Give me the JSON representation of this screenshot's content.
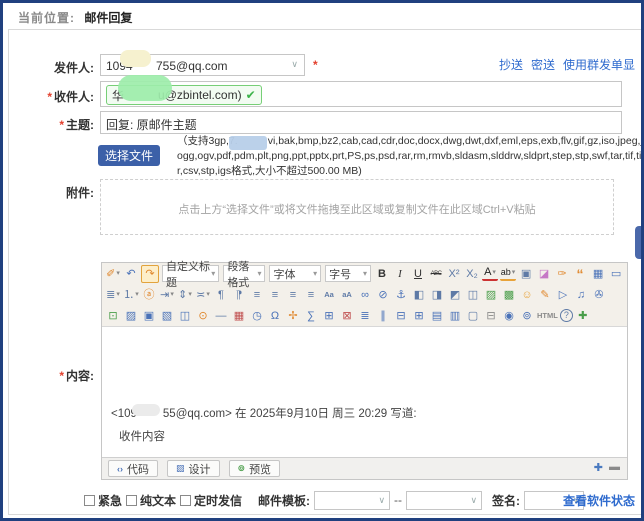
{
  "colors": {
    "frame_navy": "#20407f",
    "button_blue": "#3c60a8",
    "link_blue": "#2f6bce",
    "required_red": "#e3402e",
    "tag_green_border": "#77cf77",
    "check_green": "#3cb34a"
  },
  "breadcrumb": {
    "prefix": "当前位置:",
    "current": "邮件回复"
  },
  "form": {
    "required_mark": "*",
    "sender": {
      "label": "发件人:",
      "value_prefix": "1094",
      "value_suffix": "755@qq.com"
    },
    "header_links": [
      {
        "name": "cc-link",
        "label": "抄送"
      },
      {
        "name": "bcc-link",
        "label": "密送"
      },
      {
        "name": "group-send-link",
        "label": "使用群发单显"
      }
    ],
    "recipient": {
      "label": "收件人:",
      "tag_prefix": "华",
      "tag_suffix": "u@zbintel.com)",
      "check_icon": "✔"
    },
    "subject": {
      "label": "主题:",
      "value": "回复: 原邮件主题"
    },
    "attachment": {
      "label": "附件:",
      "choose_button": "选择文件",
      "hint_line1_pre": "（支持3gp,7.",
      "hint_line1_post": "vi,bak,bmp,bz2,cab,cad,cdr,doc,docx,dwg,dwt,dxf,eml,eps,exb,flv,gif,gz,iso,jpeg,jpg,jt",
      "hint_line2": "ogg,ogv,pdf,pdm,plt,png,ppt,pptx,prt,PS,ps,psd,rar,rm,rmvb,sldasm,slddrw,sldprt,step,stp,swf,tar,tif,tiff,txt,",
      "hint_line3": "r,csv,stp,igs格式,大小不超过500.00 MB)",
      "dropzone_text": "点击上方“选择文件”或将文件拖拽至此区域或复制文件在此区域Ctrl+V粘贴"
    },
    "content": {
      "label": "内容:"
    }
  },
  "editor": {
    "combos": [
      {
        "name": "custom-title-select",
        "label": "自定义标题"
      },
      {
        "name": "paragraph-format-select",
        "label": "段落格式"
      },
      {
        "name": "font-family-select",
        "label": "字体"
      },
      {
        "name": "font-size-select",
        "label": "字号"
      }
    ],
    "toolbar": {
      "row1_start": [
        {
          "n": "paint-format",
          "g": "✐",
          "cls": "orange drop"
        },
        {
          "n": "undo",
          "g": "↶",
          "cls": "blue"
        },
        {
          "n": "redo",
          "g": "↷",
          "cls": "orange active"
        }
      ],
      "row1_end": [
        {
          "n": "bold",
          "g": "B",
          "cls": "b"
        },
        {
          "n": "italic",
          "g": "I",
          "cls": "i"
        },
        {
          "n": "underline",
          "g": "U",
          "cls": "u"
        },
        {
          "n": "strikethrough",
          "g": "ABC",
          "cls": "st"
        },
        {
          "n": "superscript",
          "g": "X²"
        },
        {
          "n": "subscript",
          "g": "X₂"
        },
        {
          "n": "font-color",
          "g": "A",
          "cls": "fc drop"
        },
        {
          "n": "highlight-color",
          "g": "ab",
          "cls": "hc drop"
        },
        {
          "n": "bordered-text",
          "g": "▣"
        },
        {
          "n": "eraser",
          "g": "◪",
          "cls": "pink"
        },
        {
          "n": "format-painter",
          "g": "✑",
          "cls": "orange"
        },
        {
          "n": "blockquote",
          "g": "“",
          "cls": "bq"
        },
        {
          "n": "insert-calendar",
          "g": "▦",
          "cls": "blue"
        },
        {
          "n": "insert-screen",
          "g": "▭",
          "cls": "blue"
        }
      ],
      "row2": [
        {
          "n": "bullet-list",
          "g": "≣",
          "cls": "drop"
        },
        {
          "n": "ordered-list",
          "g": "⒈",
          "cls": "drop"
        },
        {
          "n": "auto-typeset",
          "g": "ⓐ",
          "cls": "orange"
        },
        {
          "n": "indent",
          "g": "⇥",
          "cls": "drop"
        },
        {
          "n": "line-height",
          "g": "⇕",
          "cls": "drop"
        },
        {
          "n": "paragraph-spacing",
          "g": "≍",
          "cls": "drop"
        },
        {
          "n": "ltr-paragraph",
          "g": "¶"
        },
        {
          "n": "rtl-paragraph",
          "g": "¶",
          "cls": "flip"
        },
        {
          "n": "align-left",
          "g": "≡"
        },
        {
          "n": "align-center",
          "g": "≡"
        },
        {
          "n": "align-right",
          "g": "≡"
        },
        {
          "n": "align-justify",
          "g": "≡"
        },
        {
          "n": "uppercase",
          "g": "Aa",
          "cls": "txt2"
        },
        {
          "n": "lowercase",
          "g": "aA",
          "cls": "txt2"
        },
        {
          "n": "insert-link",
          "g": "∞",
          "cls": "blue"
        },
        {
          "n": "unlink",
          "g": "⊘",
          "cls": "blue"
        },
        {
          "n": "anchor",
          "g": "⚓",
          "cls": "blue"
        },
        {
          "n": "image-float-left",
          "g": "◧"
        },
        {
          "n": "image-inline",
          "g": "◨"
        },
        {
          "n": "image-float-right",
          "g": "◩"
        },
        {
          "n": "image-center",
          "g": "◫"
        },
        {
          "n": "insert-image",
          "g": "▨",
          "cls": "green"
        },
        {
          "n": "photo-manager",
          "g": "▩",
          "cls": "green"
        },
        {
          "n": "emoticon",
          "g": "☺",
          "cls": "smile"
        },
        {
          "n": "scrawl",
          "g": "✎",
          "cls": "orange"
        },
        {
          "n": "insert-video",
          "g": "▷",
          "cls": "blue"
        },
        {
          "n": "insert-music",
          "g": "♫",
          "cls": "blue"
        },
        {
          "n": "attach-file",
          "g": "✇",
          "cls": "blue"
        }
      ],
      "row3": [
        {
          "n": "insert-map",
          "g": "⊡",
          "cls": "green"
        },
        {
          "n": "image-library",
          "g": "▨",
          "cls": "blue"
        },
        {
          "n": "insert-iframe",
          "g": "▣",
          "cls": "blue"
        },
        {
          "n": "page-break",
          "g": "▧",
          "cls": "blue"
        },
        {
          "n": "insert-columns",
          "g": "◫",
          "cls": "blue"
        },
        {
          "n": "snapshot",
          "g": "⊙",
          "cls": "orange"
        },
        {
          "n": "horizontal-rule",
          "g": "—"
        },
        {
          "n": "insert-date",
          "g": "▦",
          "cls": "red"
        },
        {
          "n": "insert-time",
          "g": "◷",
          "cls": "blue"
        },
        {
          "n": "special-characters",
          "g": "Ω",
          "cls": "blue"
        },
        {
          "n": "insert-seal",
          "g": "✢",
          "cls": "orange"
        },
        {
          "n": "insert-formula",
          "g": "∑",
          "cls": "blue"
        },
        {
          "n": "insert-table",
          "g": "⊞",
          "cls": "blue"
        },
        {
          "n": "delete-table",
          "g": "⊠",
          "cls": "red"
        },
        {
          "n": "insert-row",
          "g": "≣",
          "cls": "blue"
        },
        {
          "n": "insert-column",
          "g": "∥",
          "cls": "blue"
        },
        {
          "n": "merge-cells",
          "g": "⊟",
          "cls": "blue"
        },
        {
          "n": "split-cells",
          "g": "⊞",
          "cls": "blue"
        },
        {
          "n": "table-properties",
          "g": "▤",
          "cls": "blue"
        },
        {
          "n": "cell-properties",
          "g": "▥",
          "cls": "blue"
        },
        {
          "n": "new-document",
          "g": "▢"
        },
        {
          "n": "print",
          "g": "⊟",
          "cls": "gray"
        },
        {
          "n": "search-replace",
          "g": "◉",
          "cls": "blue"
        },
        {
          "n": "preview-page",
          "g": "⊚",
          "cls": "blue"
        },
        {
          "n": "html-source",
          "g": "HTML",
          "cls": "txt2 gray"
        },
        {
          "n": "help",
          "g": "?",
          "cls": "help"
        },
        {
          "n": "toggle-more",
          "g": "✚",
          "cls": "green"
        }
      ]
    },
    "quote": {
      "prefix": "<109",
      "suffix": "55@qq.com> 在 2025年9月10日 周三 20:29 写道:",
      "body_text": "收件内容"
    },
    "tabs": [
      {
        "name": "code",
        "icon": "‹›",
        "cls": "blue",
        "label": "代码"
      },
      {
        "name": "design",
        "icon": "▨",
        "cls": "blue",
        "label": "设计"
      },
      {
        "name": "preview",
        "icon": "⊚",
        "cls": "green",
        "label": "预览"
      }
    ],
    "resize": {
      "grow": "✚",
      "shrink": "▬"
    }
  },
  "options": {
    "checkboxes": [
      {
        "name": "urgent",
        "label": "紧急"
      },
      {
        "name": "plain-text",
        "label": "纯文本"
      },
      {
        "name": "scheduled-send",
        "label": "定时发信"
      }
    ],
    "template_label": "邮件模板:",
    "separator": "--",
    "signature_label": "签名:",
    "status_link": "查看软件状态"
  }
}
